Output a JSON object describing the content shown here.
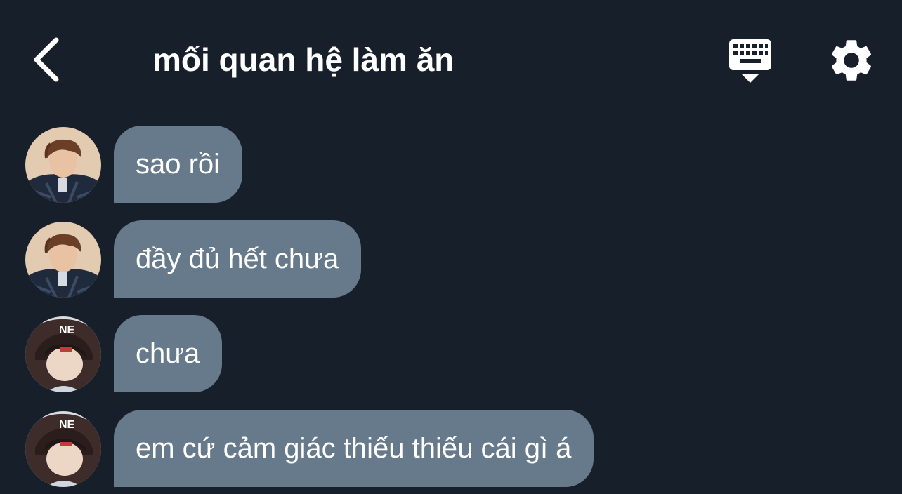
{
  "header": {
    "title": "mối quan hệ làm ăn",
    "back_icon": "chevron-left-icon",
    "keyboard_icon": "keyboard-hide-icon",
    "settings_icon": "gear-icon"
  },
  "colors": {
    "background": "#17202a",
    "bubble": "#677a8b",
    "text": "#ffffff"
  },
  "messages": [
    {
      "sender": "boy-brown-hair",
      "text": "sao rồi"
    },
    {
      "sender": "boy-brown-hair",
      "text": "đầy đủ hết chưa"
    },
    {
      "sender": "boy-hooded",
      "text": "chưa"
    },
    {
      "sender": "boy-hooded",
      "text": "em cứ cảm giác thiếu thiếu cái gì á"
    }
  ]
}
